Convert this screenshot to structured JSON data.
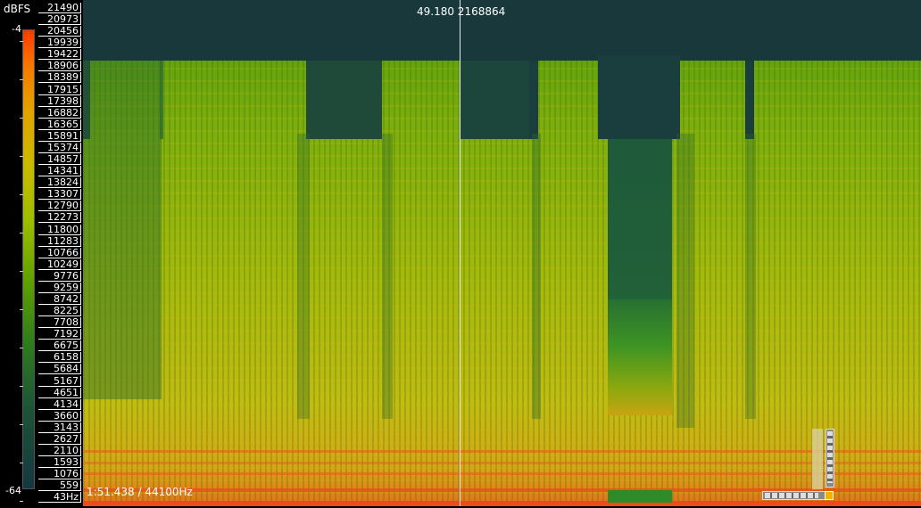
{
  "legend": {
    "unit_label": "dBFS",
    "max_label": "-4",
    "min_label": "-64"
  },
  "frequency_axis": {
    "labels": [
      "21490",
      "20973",
      "20456",
      "19939",
      "19422",
      "18906",
      "18389",
      "17915",
      "17398",
      "16882",
      "16365",
      "15891",
      "15374",
      "14857",
      "14341",
      "13824",
      "13307",
      "12790",
      "12273",
      "11800",
      "11283",
      "10766",
      "10249",
      "9776",
      "9259",
      "8742",
      "8225",
      "7708",
      "7192",
      "6675",
      "6158",
      "5684",
      "5167",
      "4651",
      "4134",
      "3660",
      "3143",
      "2627",
      "2110",
      "1593",
      "1076",
      "559",
      "43Hz"
    ]
  },
  "cursor": {
    "readout": "49.180   2168864"
  },
  "status": {
    "time_readout": "1:51.438 / 44100Hz"
  },
  "colors": {
    "background": "#000000",
    "text": "#ffffff",
    "cursor_line": "#e8e8e8"
  },
  "icons": {
    "zoom_knob": "zoom-handle-icon"
  }
}
